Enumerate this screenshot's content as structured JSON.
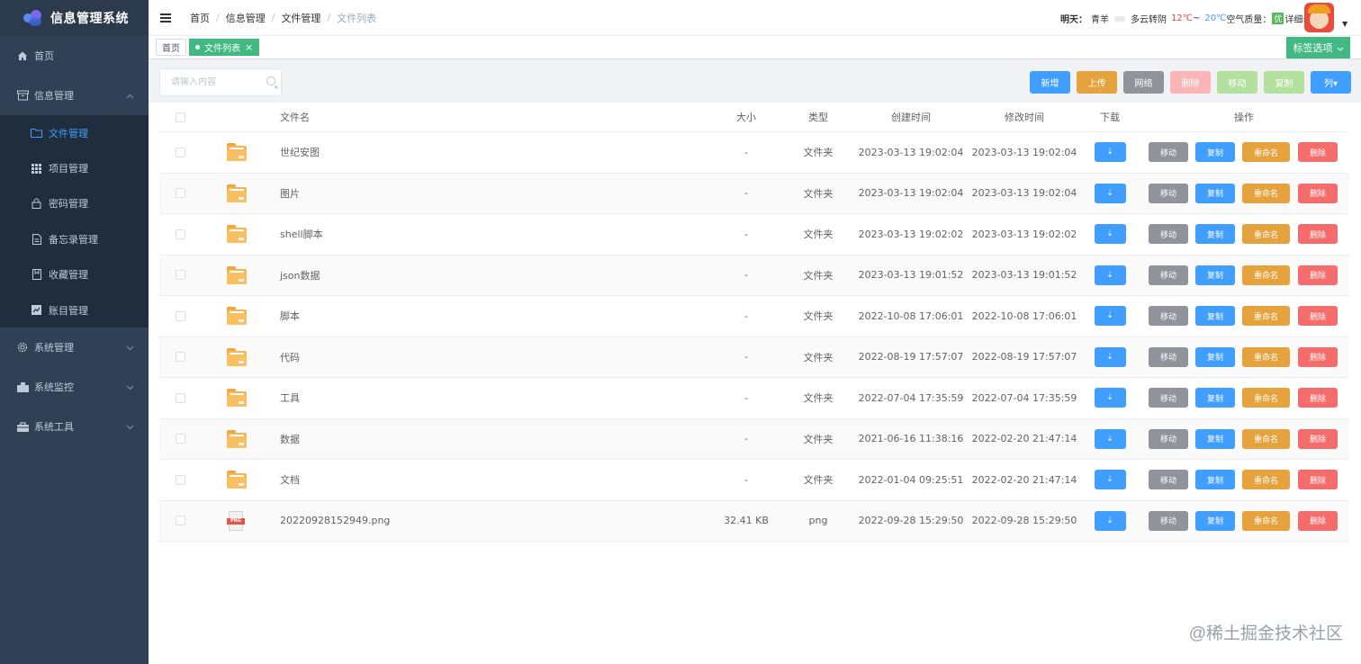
{
  "app": {
    "title": "信息管理系统"
  },
  "sidebar": {
    "items": [
      {
        "label": "首页",
        "icon": "home-icon"
      },
      {
        "label": "信息管理",
        "icon": "archive-icon",
        "expanded": true,
        "children": [
          {
            "label": "文件管理",
            "icon": "folder-icon",
            "active": true
          },
          {
            "label": "项目管理",
            "icon": "grid-icon"
          },
          {
            "label": "密码管理",
            "icon": "lock-icon"
          },
          {
            "label": "备忘录管理",
            "icon": "document-icon"
          },
          {
            "label": "收藏管理",
            "icon": "bookmark-icon"
          },
          {
            "label": "账目管理",
            "icon": "chart-icon"
          }
        ]
      },
      {
        "label": "系统管理",
        "icon": "gear-icon"
      },
      {
        "label": "系统监控",
        "icon": "monitor-icon"
      },
      {
        "label": "系统工具",
        "icon": "toolbox-icon"
      }
    ]
  },
  "header": {
    "breadcrumb": [
      "首页",
      "信息管理",
      "文件管理",
      "文件列表"
    ],
    "weather": {
      "day_label": "明天：",
      "city": "青羊",
      "condition": "多云转阴",
      "high": "12℃",
      "tilde": "~",
      "low": "20℃",
      "aqi_label": "空气质量：",
      "aqi_value": "优",
      "detail": "详细»"
    }
  },
  "tags": {
    "home": "首页",
    "active": "文件列表",
    "options_label": "标签选项"
  },
  "toolbar": {
    "search_placeholder": "请输入内容",
    "buttons": [
      {
        "label": "新增",
        "color": "#409eff"
      },
      {
        "label": "上传",
        "color": "#e6a23c"
      },
      {
        "label": "网络",
        "color": "#909399"
      },
      {
        "label": "删除",
        "color": "#fab6b6"
      },
      {
        "label": "移动",
        "color": "#b3e19d"
      },
      {
        "label": "复制",
        "color": "#b3e19d"
      },
      {
        "label": "列▾",
        "color": "#409eff"
      }
    ]
  },
  "table": {
    "headers": {
      "name": "文件名",
      "size": "大小",
      "type": "类型",
      "created": "创建时间",
      "modified": "修改时间",
      "download": "下载",
      "actions": "操作"
    },
    "download_label": "⇣",
    "action_buttons": [
      {
        "label": "移动",
        "color": "#909399"
      },
      {
        "label": "复制",
        "color": "#409eff"
      },
      {
        "label": "重命名",
        "color": "#e6a23c"
      },
      {
        "label": "删除",
        "color": "#f56c6c"
      }
    ],
    "rows": [
      {
        "name": "世纪安图",
        "size": "-",
        "type": "文件夹",
        "created": "2023-03-13 19:02:04",
        "modified": "2023-03-13 19:02:04",
        "icon": "folder-icon"
      },
      {
        "name": "图片",
        "size": "-",
        "type": "文件夹",
        "created": "2023-03-13 19:02:04",
        "modified": "2023-03-13 19:02:04",
        "icon": "folder-icon"
      },
      {
        "name": "shell脚本",
        "size": "-",
        "type": "文件夹",
        "created": "2023-03-13 19:02:02",
        "modified": "2023-03-13 19:02:02",
        "icon": "folder-icon"
      },
      {
        "name": "json数据",
        "size": "-",
        "type": "文件夹",
        "created": "2023-03-13 19:01:52",
        "modified": "2023-03-13 19:01:52",
        "icon": "folder-icon"
      },
      {
        "name": "脚本",
        "size": "-",
        "type": "文件夹",
        "created": "2022-10-08 17:06:01",
        "modified": "2022-10-08 17:06:01",
        "icon": "folder-icon"
      },
      {
        "name": "代码",
        "size": "-",
        "type": "文件夹",
        "created": "2022-08-19 17:57:07",
        "modified": "2022-08-19 17:57:07",
        "icon": "folder-icon"
      },
      {
        "name": "工具",
        "size": "-",
        "type": "文件夹",
        "created": "2022-07-04 17:35:59",
        "modified": "2022-07-04 17:35:59",
        "icon": "folder-icon"
      },
      {
        "name": "数据",
        "size": "-",
        "type": "文件夹",
        "created": "2021-06-16 11:38:16",
        "modified": "2022-02-20 21:47:14",
        "icon": "folder-icon"
      },
      {
        "name": "文档",
        "size": "-",
        "type": "文件夹",
        "created": "2022-01-04 09:25:51",
        "modified": "2022-02-20 21:47:14",
        "icon": "folder-icon"
      },
      {
        "name": "20220928152949.png",
        "size": "32.41 KB",
        "type": "png",
        "created": "2022-09-28 15:29:50",
        "modified": "2022-09-28 15:29:50",
        "icon": "png-file-icon",
        "icon_text": "PNG"
      }
    ]
  },
  "watermark": "@稀土掘金技术社区"
}
